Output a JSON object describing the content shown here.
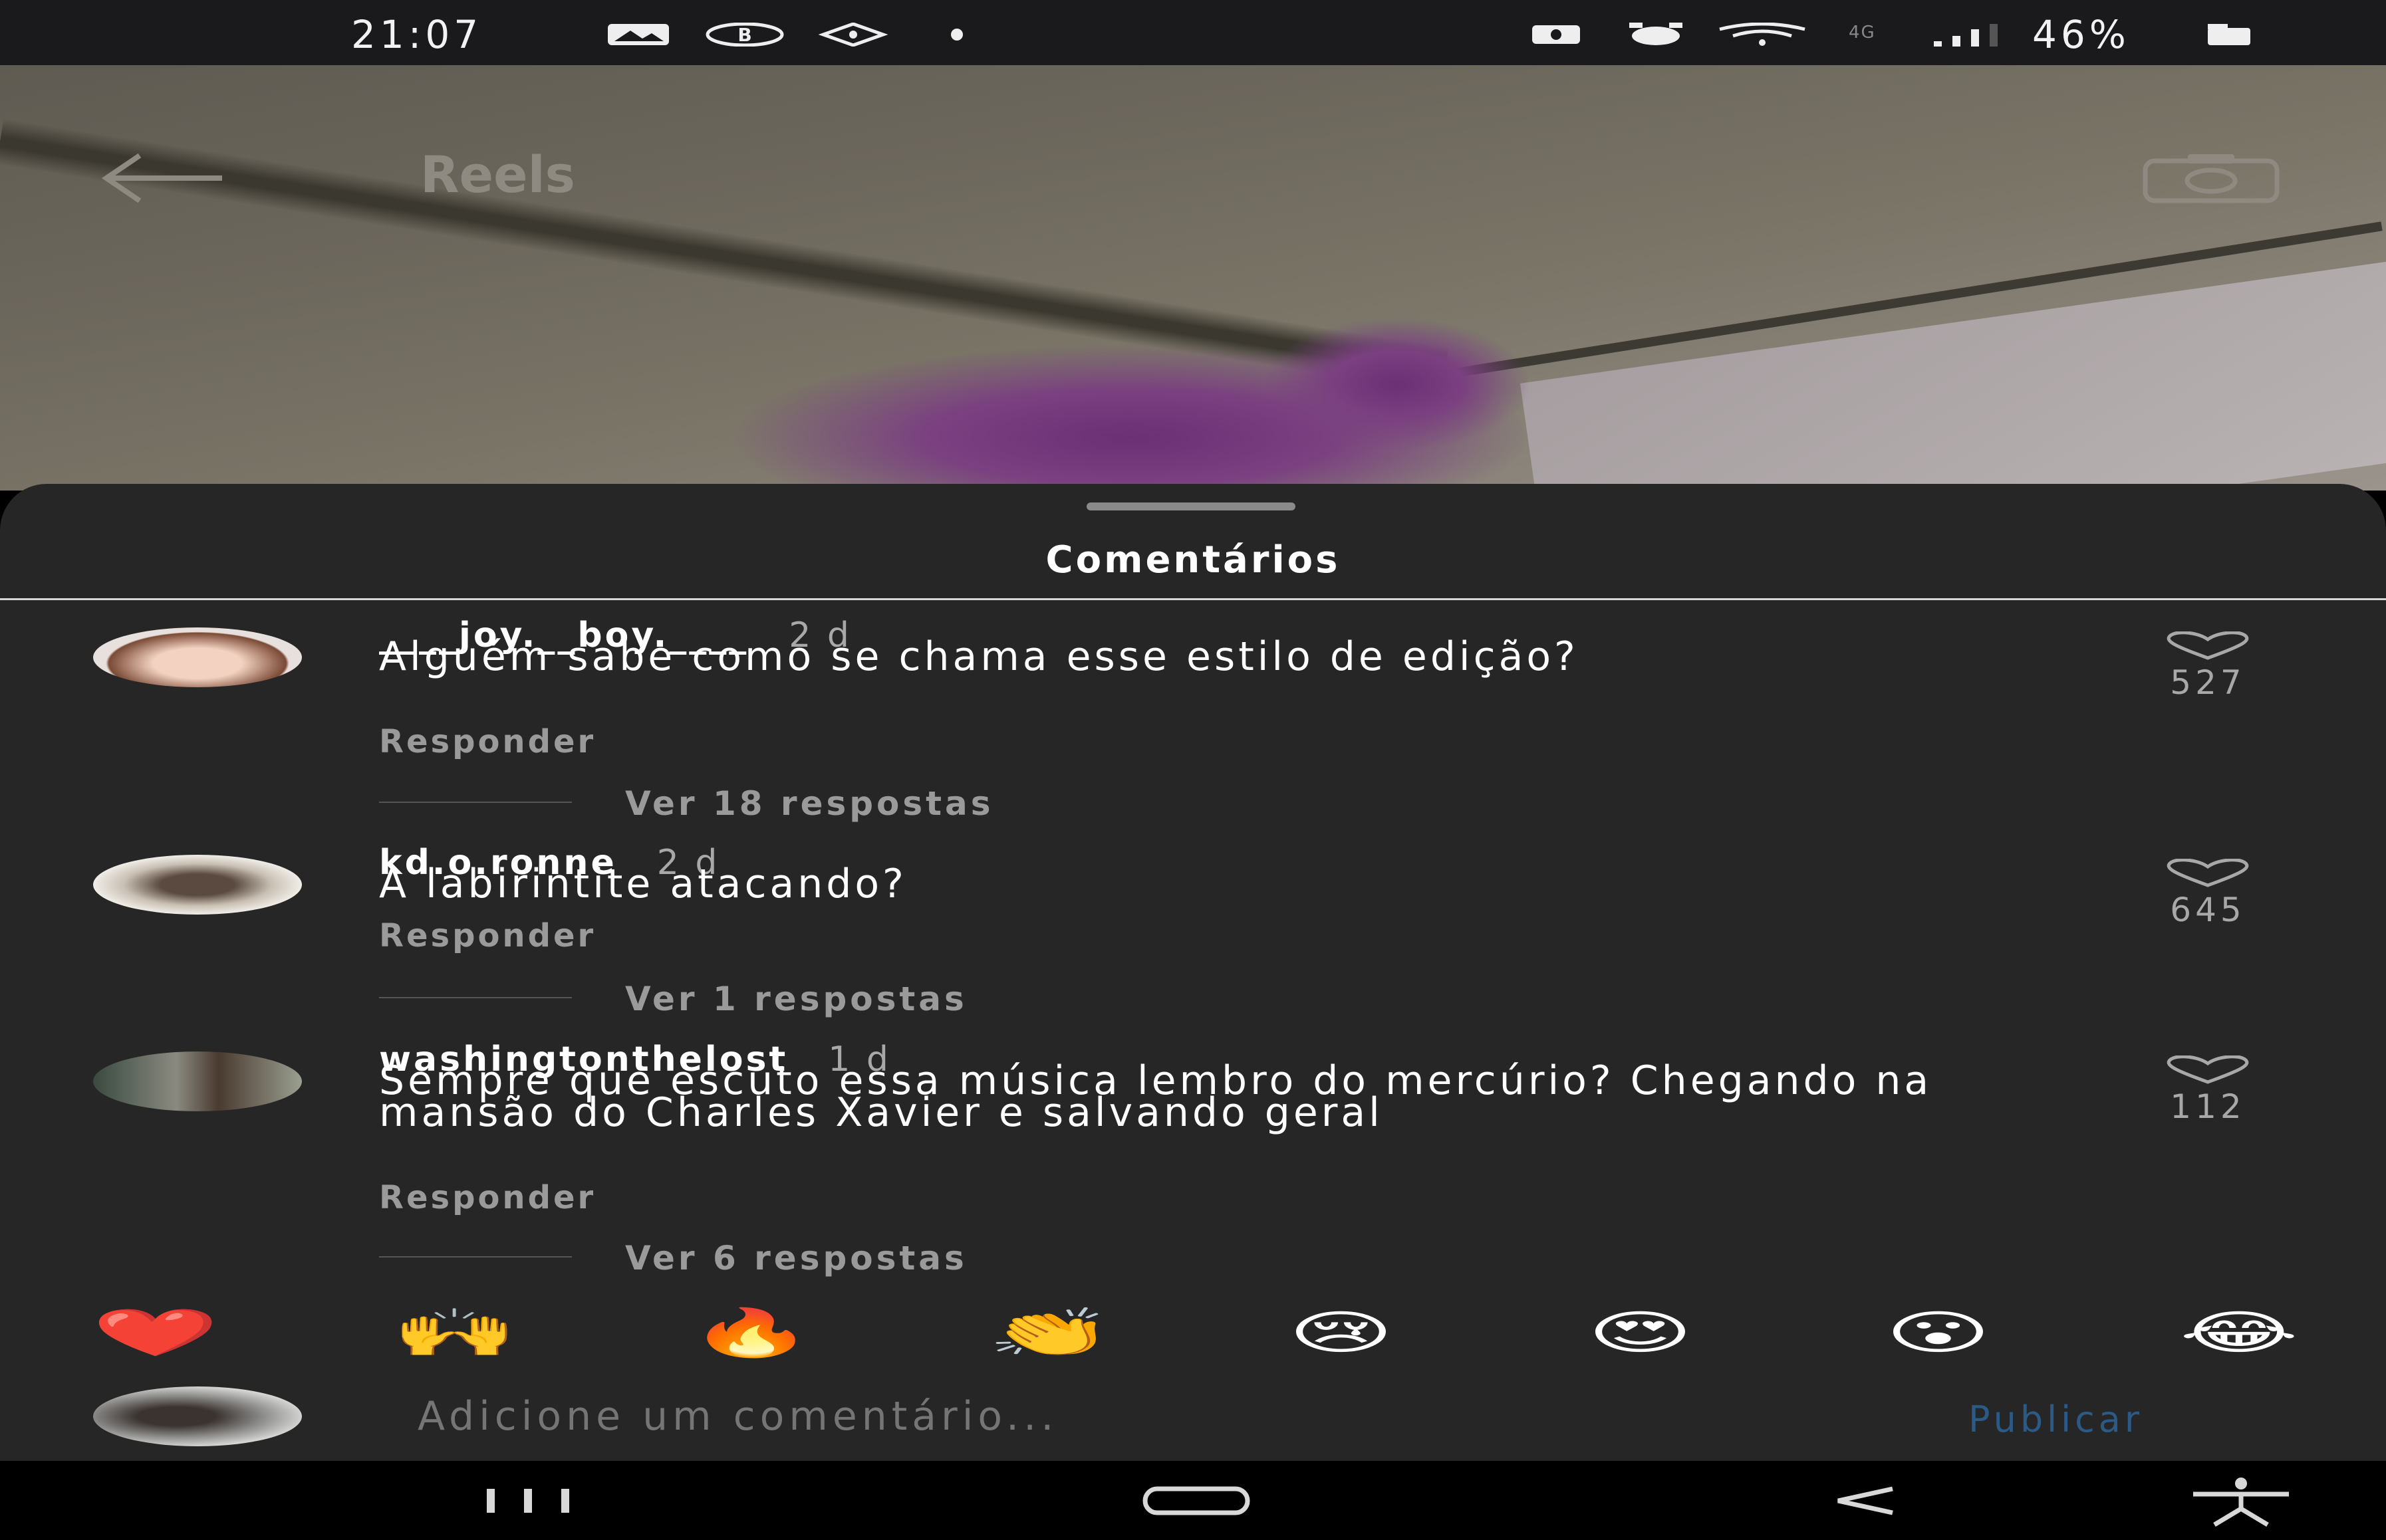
{
  "status_bar": {
    "time": "21:07",
    "battery": "46%",
    "network": "4G"
  },
  "header": {
    "title": "Reels"
  },
  "sheet": {
    "title": "Comentários"
  },
  "comments": [
    {
      "user": "____joy.__boy.____",
      "time": "2 d",
      "text": "Alguém sabe como se chama esse estilo de edição?",
      "reply": "Responder",
      "likes": "527",
      "view_replies": "Ver 18 respostas"
    },
    {
      "user": "kd.o.ronne",
      "time": "2 d",
      "text": "A labirintite atacando?",
      "reply": "Responder",
      "likes": "645",
      "view_replies": "Ver 1 respostas"
    },
    {
      "user": "washingtonthelost",
      "time": "1 d",
      "text": "Sempre que escuto essa música lembro do mercúrio? Chegando na mansão do Charles Xavier e salvando geral",
      "reply": "Responder",
      "likes": "112",
      "view_replies": "Ver 6 respostas"
    }
  ],
  "emojis": [
    "❤️",
    "🙌",
    "🔥",
    "👏",
    "😢",
    "😍",
    "😮",
    "😂"
  ],
  "composer": {
    "placeholder": "Adicione um comentário...",
    "post": "Publicar"
  },
  "colors": {
    "sheet_bg": "#262626",
    "post_link": "#2b5a86"
  }
}
